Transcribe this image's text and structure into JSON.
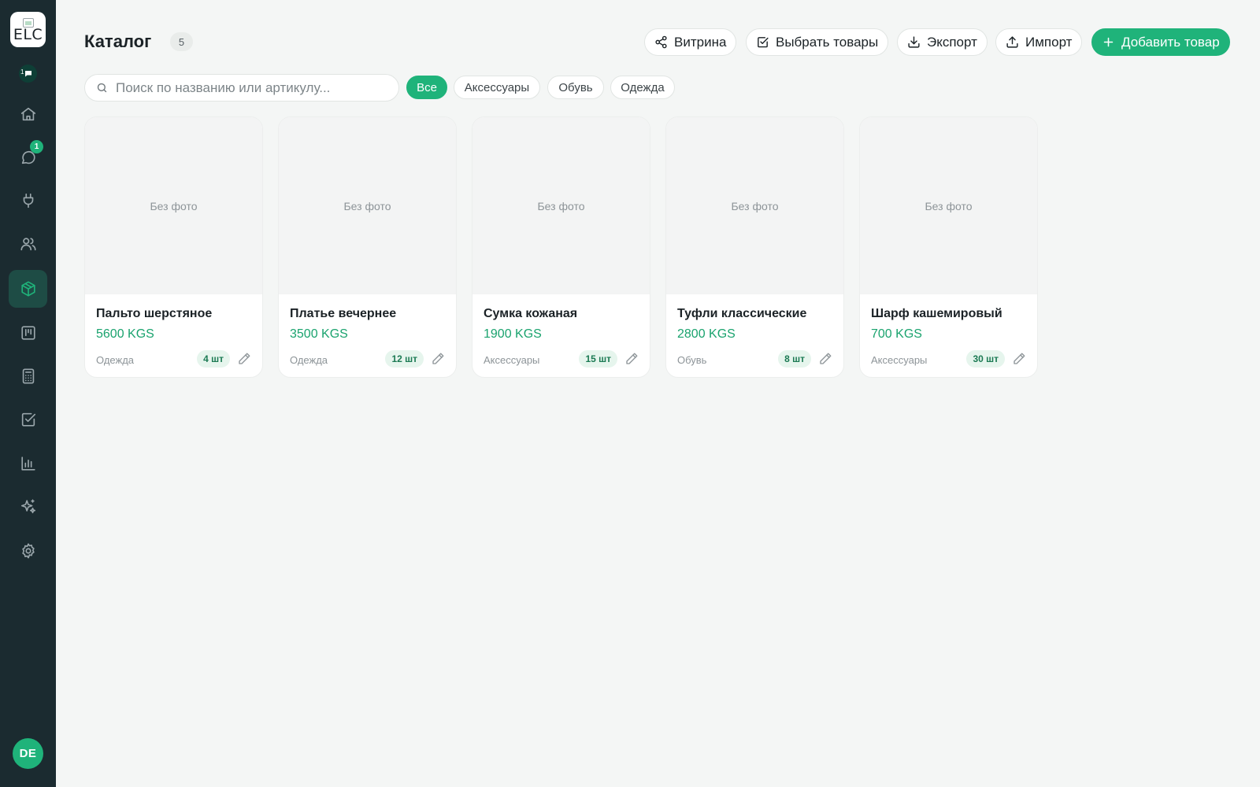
{
  "sidebar": {
    "logo_alt": "ELC",
    "chat_count": "1",
    "nav": [
      {
        "id": "home",
        "icon": "home-icon"
      },
      {
        "id": "chats",
        "icon": "chat-icon",
        "badge": "1"
      },
      {
        "id": "integrations",
        "icon": "plug-icon"
      },
      {
        "id": "customers",
        "icon": "users-icon"
      },
      {
        "id": "catalog",
        "icon": "box-icon",
        "active": true
      },
      {
        "id": "kanban",
        "icon": "kanban-icon"
      },
      {
        "id": "calculator",
        "icon": "calculator-icon"
      },
      {
        "id": "tasks",
        "icon": "checkbox-icon"
      },
      {
        "id": "analytics",
        "icon": "bar-chart-icon"
      },
      {
        "id": "ai",
        "icon": "sparkles-icon"
      },
      {
        "id": "settings",
        "icon": "gear-icon"
      }
    ],
    "user_initials": "DE"
  },
  "header": {
    "title": "Каталог",
    "count": "5",
    "buttons": {
      "storefront": "Витрина",
      "select": "Выбрать товары",
      "export": "Экспорт",
      "import": "Импорт",
      "add": "Добавить товар"
    }
  },
  "search": {
    "placeholder": "Поиск по названию или артикулу..."
  },
  "filters": [
    {
      "label": "Все",
      "active": true
    },
    {
      "label": "Аксессуары"
    },
    {
      "label": "Обувь"
    },
    {
      "label": "Одежда"
    }
  ],
  "no_photo": "Без фото",
  "products": [
    {
      "name": "Пальто шерстяное",
      "price": "5600 KGS",
      "category": "Одежда",
      "qty": "4 шт"
    },
    {
      "name": "Платье вечернее",
      "price": "3500 KGS",
      "category": "Одежда",
      "qty": "12 шт"
    },
    {
      "name": "Сумка кожаная",
      "price": "1900 KGS",
      "category": "Аксессуары",
      "qty": "15 шт"
    },
    {
      "name": "Туфли классические",
      "price": "2800 KGS",
      "category": "Обувь",
      "qty": "8 шт"
    },
    {
      "name": "Шарф кашемировый",
      "price": "700 KGS",
      "category": "Аксессуары",
      "qty": "30 шт"
    }
  ],
  "colors": {
    "accent": "#1fb37a",
    "sidebar": "#1b2b30",
    "sidebar_active": "#1e4c45",
    "icon": "#9aa6ab"
  }
}
